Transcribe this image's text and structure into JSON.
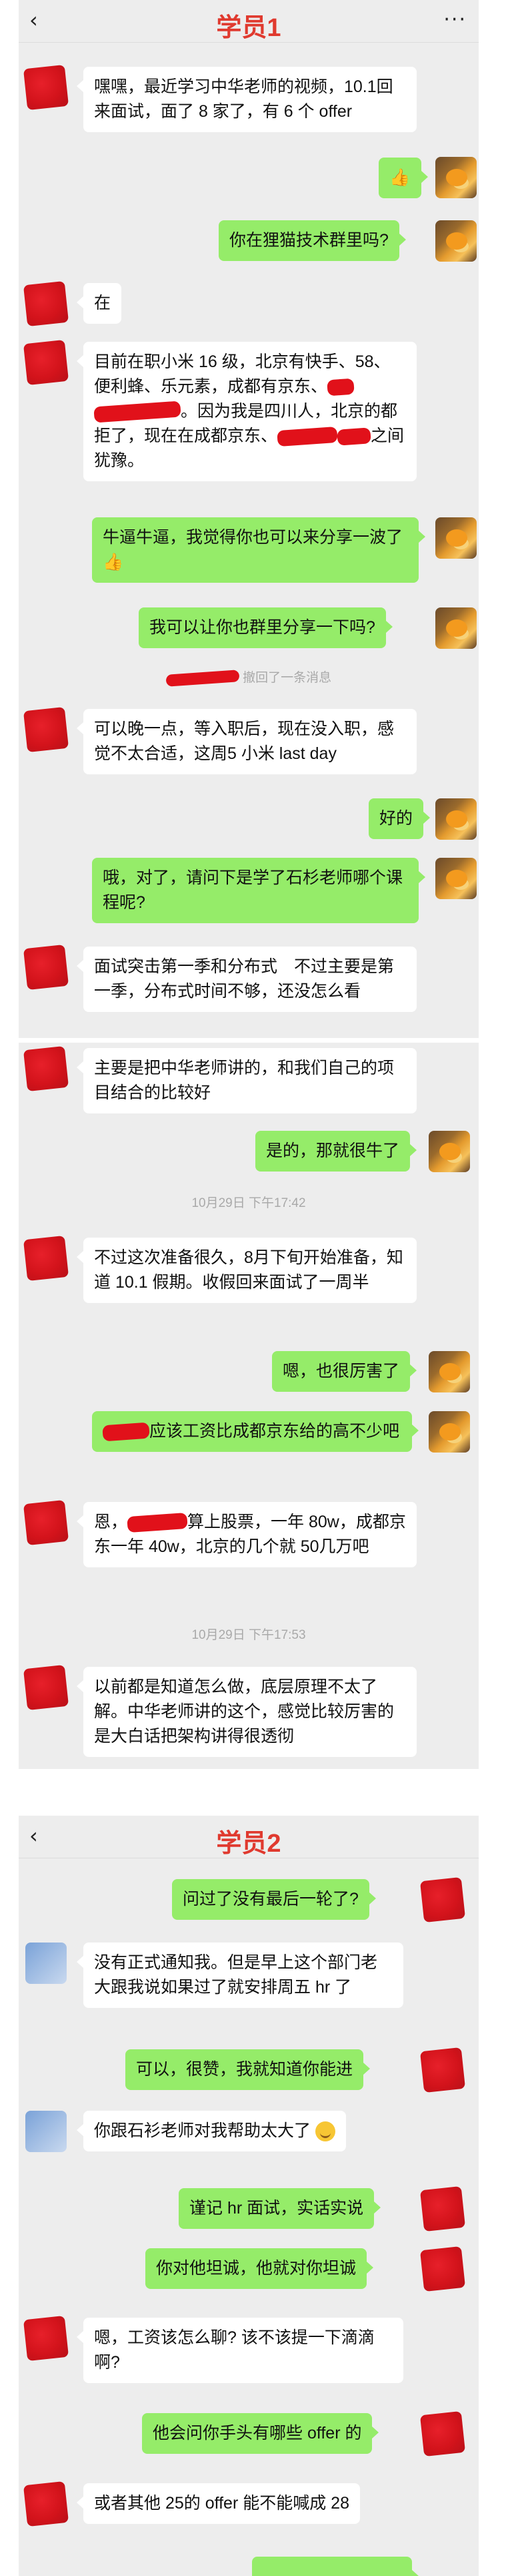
{
  "chat1": {
    "title": "学员1",
    "back_icon": "‹",
    "more_icon": "···",
    "messages": [
      {
        "text": "嘿嘿，最近学习中华老师的视频，10.1回来面试，面了 8 家了，有 6 个 offer"
      },
      {
        "text": "👍"
      },
      {
        "text": "你在狸猫技术群里吗?"
      },
      {
        "text": "在"
      },
      {
        "text_a": "目前在职小米 16 级，北京有快手、58、便利蜂、乐元素，成都有京东、",
        "text_b": "。因为我是四川人，北京的都拒了，现在在成都京东、",
        "text_c": "之间犹豫。"
      },
      {
        "text": "牛逼牛逼，我觉得你也可以来分享一波了👍"
      },
      {
        "text": "我可以让你也群里分享一下吗?"
      },
      {
        "text": "撤回了一条消息"
      },
      {
        "text": "可以晚一点，等入职后，现在没入职，感觉不太合适，这周5 小米 last day"
      },
      {
        "text": "好的"
      },
      {
        "text": "哦，对了，请问下是学了石杉老师哪个课程呢?"
      },
      {
        "text": "面试突击第一季和分布式　不过主要是第一季，分布式时间不够，还没怎么看"
      }
    ]
  },
  "chat1b": {
    "messages": [
      {
        "text": "主要是把中华老师讲的，和我们自己的项目结合的比较好"
      },
      {
        "text": "是的，那就很牛了"
      },
      {
        "text": "10月29日 下午17:42"
      },
      {
        "text": "不过这次准备很久，8月下旬开始准备，知道 10.1 假期。收假回来面试了一周半"
      },
      {
        "text": "嗯，也很厉害了"
      },
      {
        "text": "应该工资比成都京东给的高不少吧"
      },
      {
        "text_a": "恩，",
        "text_b": "算上股票，一年 80w，成都京东一年 40w，北京的几个就 50几万吧"
      },
      {
        "text": "10月29日 下午17:53"
      },
      {
        "text": "以前都是知道怎么做，底层原理不太了解。中华老师讲的这个，感觉比较厉害的是大白话把架构讲得很透彻"
      }
    ]
  },
  "chat2": {
    "title": "学员2",
    "back_icon": "‹",
    "messages": [
      {
        "text": "问过了没有最后一轮了?"
      },
      {
        "text": "没有正式通知我。但是早上这个部门老大跟我说如果过了就安排周五 hr 了"
      },
      {
        "text": "可以，很赞，我就知道你能进"
      },
      {
        "text": "你跟石衫老师对我帮助太大了"
      },
      {
        "text": "谨记 hr 面试，实话实说"
      },
      {
        "text": "你对他坦诚，他就对你坦诚"
      },
      {
        "text": "嗯，工资该怎么聊? 该不该提一下滴滴啊?"
      },
      {
        "text": "他会问你手头有哪些 offer 的"
      },
      {
        "text": "或者其他 25的 offer 能不能喊成 28"
      }
    ]
  },
  "colors": {
    "bg": "#ededed",
    "green_bubble": "#95ec69",
    "white_bubble": "#ffffff",
    "title_red": "#e03a2f"
  }
}
